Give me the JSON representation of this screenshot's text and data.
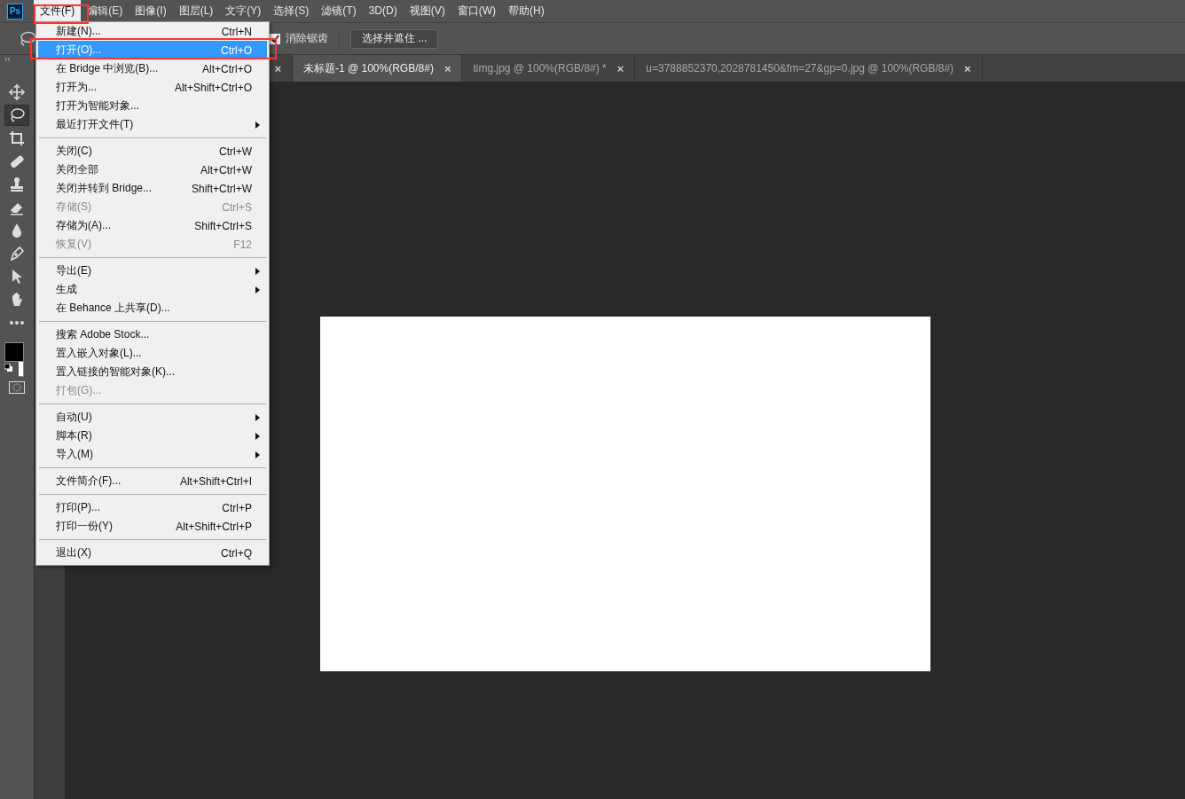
{
  "app_logo": "Ps",
  "menubar": [
    {
      "label": "文件(F)",
      "selected": true
    },
    {
      "label": "编辑(E)",
      "selected": false
    },
    {
      "label": "图像(I)",
      "selected": false
    },
    {
      "label": "图层(L)",
      "selected": false
    },
    {
      "label": "文字(Y)",
      "selected": false
    },
    {
      "label": "选择(S)",
      "selected": false
    },
    {
      "label": "滤镜(T)",
      "selected": false
    },
    {
      "label": "3D(D)",
      "selected": false
    },
    {
      "label": "视图(V)",
      "selected": false
    },
    {
      "label": "窗口(W)",
      "selected": false
    },
    {
      "label": "帮助(H)",
      "selected": false
    }
  ],
  "options_bar": {
    "antialias": {
      "label": "消除锯齿",
      "checked": true
    },
    "select_mask_button": "选择并遮住 ..."
  },
  "panel_collapse": "‹‹",
  "tabs": [
    {
      "close": "×",
      "selected": false
    },
    {
      "label": "未标题-1 @ 100%(RGB/8#)",
      "close": "×",
      "selected": true
    },
    {
      "label": "timg.jpg @ 100%(RGB/8#) *",
      "close": "×",
      "selected": false
    },
    {
      "label": "u=3788852370,2028781450&fm=27&gp=0.jpg @ 100%(RGB/8#)",
      "close": "×",
      "selected": false
    }
  ],
  "tools": [
    {
      "kind": "move",
      "selected": false
    },
    {
      "kind": "lasso",
      "selected": true
    },
    {
      "kind": "crop",
      "selected": false
    },
    {
      "kind": "bandage",
      "selected": false
    },
    {
      "kind": "stamp",
      "selected": false
    },
    {
      "kind": "eraser",
      "selected": false
    },
    {
      "kind": "drop",
      "selected": false
    },
    {
      "kind": "pen",
      "selected": false
    },
    {
      "kind": "arrow",
      "selected": false
    },
    {
      "kind": "hand",
      "selected": false
    },
    {
      "kind": "more",
      "selected": false
    }
  ],
  "file_menu": [
    [
      {
        "label": "新建(N)...",
        "shortcut": "Ctrl+N",
        "disabled": false,
        "submenu": false,
        "selected": false
      },
      {
        "label": "打开(O)...",
        "shortcut": "Ctrl+O",
        "disabled": false,
        "submenu": false,
        "selected": true
      },
      {
        "label": "在 Bridge 中浏览(B)...",
        "shortcut": "Alt+Ctrl+O",
        "disabled": false,
        "submenu": false,
        "selected": false
      },
      {
        "label": "打开为...",
        "shortcut": "Alt+Shift+Ctrl+O",
        "disabled": false,
        "submenu": false,
        "selected": false
      },
      {
        "label": "打开为智能对象...",
        "disabled": false,
        "submenu": false,
        "selected": false
      },
      {
        "label": "最近打开文件(T)",
        "disabled": false,
        "submenu": true,
        "selected": false
      }
    ],
    [
      {
        "label": "关闭(C)",
        "shortcut": "Ctrl+W",
        "disabled": false,
        "submenu": false,
        "selected": false
      },
      {
        "label": "关闭全部",
        "shortcut": "Alt+Ctrl+W",
        "disabled": false,
        "submenu": false,
        "selected": false
      },
      {
        "label": "关闭并转到 Bridge...",
        "shortcut": "Shift+Ctrl+W",
        "disabled": false,
        "submenu": false,
        "selected": false
      },
      {
        "label": "存储(S)",
        "shortcut": "Ctrl+S",
        "disabled": true,
        "submenu": false,
        "selected": false
      },
      {
        "label": "存储为(A)...",
        "shortcut": "Shift+Ctrl+S",
        "disabled": false,
        "submenu": false,
        "selected": false
      },
      {
        "label": "恢复(V)",
        "shortcut": "F12",
        "disabled": true,
        "submenu": false,
        "selected": false
      }
    ],
    [
      {
        "label": "导出(E)",
        "disabled": false,
        "submenu": true,
        "selected": false
      },
      {
        "label": "生成",
        "disabled": false,
        "submenu": true,
        "selected": false
      },
      {
        "label": "在 Behance 上共享(D)...",
        "disabled": false,
        "submenu": false,
        "selected": false
      }
    ],
    [
      {
        "label": "搜索 Adobe Stock...",
        "disabled": false,
        "submenu": false,
        "selected": false
      },
      {
        "label": "置入嵌入对象(L)...",
        "disabled": false,
        "submenu": false,
        "selected": false
      },
      {
        "label": "置入链接的智能对象(K)...",
        "disabled": false,
        "submenu": false,
        "selected": false
      },
      {
        "label": "打包(G)...",
        "disabled": true,
        "submenu": false,
        "selected": false
      }
    ],
    [
      {
        "label": "自动(U)",
        "disabled": false,
        "submenu": true,
        "selected": false
      },
      {
        "label": "脚本(R)",
        "disabled": false,
        "submenu": true,
        "selected": false
      },
      {
        "label": "导入(M)",
        "disabled": false,
        "submenu": true,
        "selected": false
      }
    ],
    [
      {
        "label": "文件简介(F)...",
        "shortcut": "Alt+Shift+Ctrl+I",
        "disabled": false,
        "submenu": false,
        "selected": false
      }
    ],
    [
      {
        "label": "打印(P)...",
        "shortcut": "Ctrl+P",
        "disabled": false,
        "submenu": false,
        "selected": false
      },
      {
        "label": "打印一份(Y)",
        "shortcut": "Alt+Shift+Ctrl+P",
        "disabled": false,
        "submenu": false,
        "selected": false
      }
    ],
    [
      {
        "label": "退出(X)",
        "shortcut": "Ctrl+Q",
        "disabled": false,
        "submenu": false,
        "selected": false
      }
    ]
  ]
}
